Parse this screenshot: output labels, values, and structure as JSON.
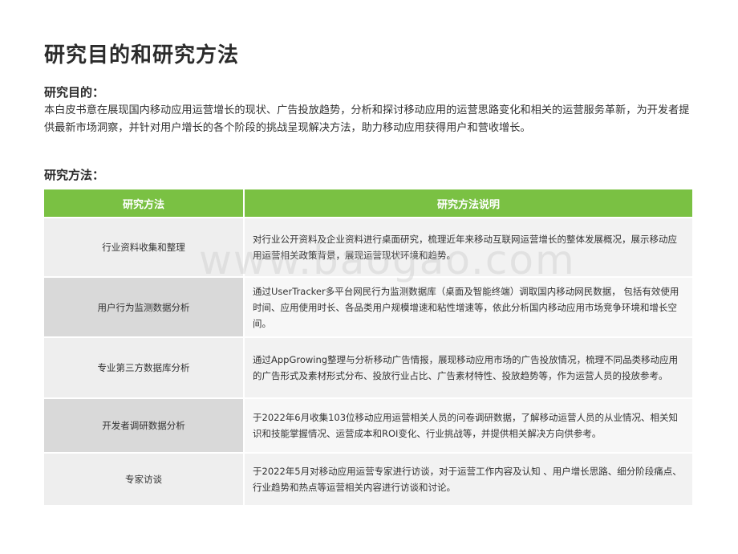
{
  "page": {
    "title": "研究目的和研究方法"
  },
  "purpose": {
    "heading": "研究目的：",
    "text": "本白皮书意在展现国内移动应用运营增长的现状、广告投放趋势，分析和探讨移动应用的运营思路变化和相关的运营服务革新，为开发者提供最新市场洞察，并针对用户增长的各个阶段的挑战呈现解决方法，助力移动应用获得用户和营收增长。"
  },
  "methods": {
    "heading": "研究方法：",
    "columns": [
      "研究方法",
      "研究方法说明"
    ],
    "rows": [
      {
        "name": "行业资料收集和整理",
        "description": "对行业公开资料及企业资料进行桌面研究，梳理近年来移动互联网运营增长的整体发展概况，展示移动应用运营相关政策背景，展现运营现状环境和趋势。"
      },
      {
        "name": "用户行为监测数据分析",
        "description": "通过UserTracker多平台网民行为监测数据库（桌面及智能终端）调取国内移动网民数据， 包括有效使用时间、应用使用时长、各品类用户规模增速和粘性增速等，依此分析国内移动应用市场竞争环境和增长空间。"
      },
      {
        "name": "专业第三方数据库分析",
        "description": "通过AppGrowing整理与分析移动广告情报，展现移动应用市场的广告投放情况，梳理不同品类移动应用的广告形式及素材形式分布、投放行业占比、广告素材特性、投放趋势等，作为运营人员的投放参考。"
      },
      {
        "name": "开发者调研数据分析",
        "description": "于2022年6月收集103位移动应用运营相关人员的问卷调研数据，了解移动运营人员的从业情况、相关知识和技能掌握情况、运营成本和ROI变化、行业挑战等，并提供相关解决方向供参考。"
      },
      {
        "name": "专家访谈",
        "description": "于2022年5月对移动应用运营专家进行访谈，对于运营工作内容及认知 、用户增长思路、细分阶段痛点、行业趋势和热点等运营相关内容进行访谈和讨论。"
      }
    ]
  },
  "watermark": {
    "text": "www.baogao.com"
  },
  "colors": {
    "header_green": "#7ac143",
    "row_gray_light": "#eeeeee",
    "row_gray_dark": "#d9d9d9"
  }
}
